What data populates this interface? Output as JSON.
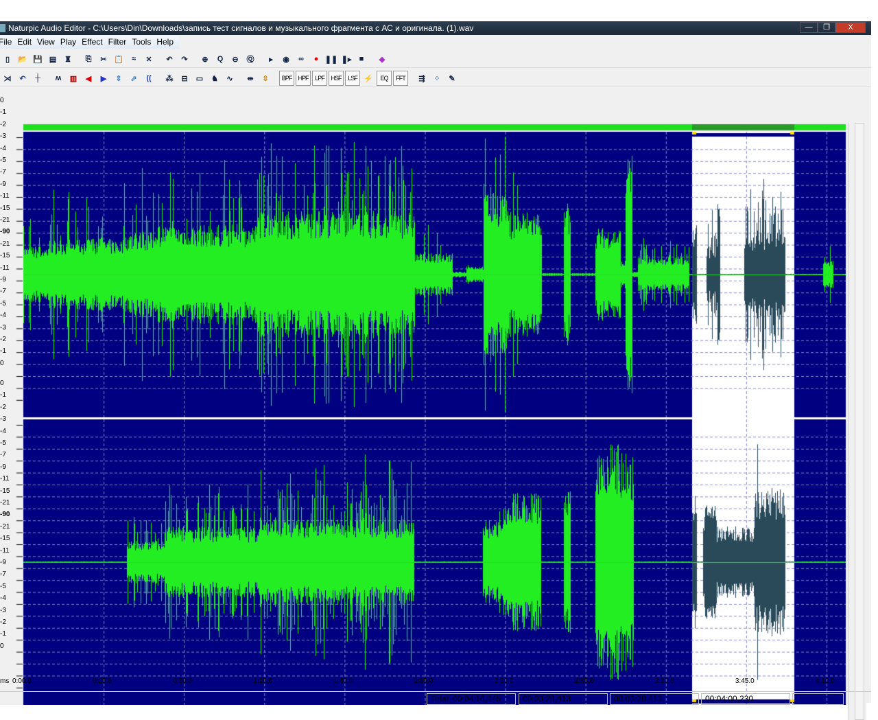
{
  "window": {
    "title": "Naturpic Audio Editor - C:\\Users\\Din\\Downloads\\запись тест сигналов и музыкального фрагмента с АС и оригинала. (1).wav",
    "minimize": "—",
    "restore": "❐",
    "close": "X"
  },
  "menu": [
    "File",
    "Edit",
    "View",
    "Play",
    "Effect",
    "Filter",
    "Tools",
    "Help"
  ],
  "toolbar1": [
    {
      "icon": "new-icon",
      "g": "▯"
    },
    {
      "icon": "open-icon",
      "g": "📂"
    },
    {
      "icon": "save-icon",
      "g": "💾"
    },
    {
      "icon": "properties-icon",
      "g": "▤"
    },
    {
      "icon": "tuning-icon",
      "g": "♜"
    },
    {
      "sep": true
    },
    {
      "icon": "copy-icon",
      "g": "⎘"
    },
    {
      "icon": "cut-icon",
      "g": "✂"
    },
    {
      "icon": "paste-icon",
      "g": "📋"
    },
    {
      "icon": "mix-paste-icon",
      "g": "≈"
    },
    {
      "icon": "delete-icon",
      "g": "✕"
    },
    {
      "sep": true
    },
    {
      "icon": "undo-icon",
      "g": "↶"
    },
    {
      "icon": "redo-icon",
      "g": "↷"
    },
    {
      "sep": true
    },
    {
      "icon": "zoom-in-icon",
      "g": "⊕"
    },
    {
      "icon": "zoom-selection-icon",
      "g": "Q"
    },
    {
      "icon": "zoom-out-icon",
      "g": "⊖"
    },
    {
      "icon": "zoom-full-icon",
      "g": "Ⓠ"
    },
    {
      "sep": true
    },
    {
      "icon": "play-icon",
      "g": "▸"
    },
    {
      "icon": "play-selection-icon",
      "g": "◉"
    },
    {
      "icon": "loop-icon",
      "g": "∞"
    },
    {
      "icon": "record-icon",
      "g": "●",
      "c": "#e00"
    },
    {
      "icon": "pause-icon",
      "g": "❚❚"
    },
    {
      "icon": "step-icon",
      "g": "❚▸"
    },
    {
      "icon": "stop-icon",
      "g": "■"
    },
    {
      "sep": true
    },
    {
      "icon": "help-book-icon",
      "g": "◆",
      "c": "#a3c"
    }
  ],
  "toolbar2": [
    {
      "icon": "trim-icon",
      "g": "⋊"
    },
    {
      "icon": "reverse-icon",
      "g": "↶",
      "c": "#24a"
    },
    {
      "icon": "split-icon",
      "g": "┼"
    },
    {
      "sep": true
    },
    {
      "icon": "amplify-icon",
      "g": "ʍ"
    },
    {
      "icon": "normalize-icon",
      "g": "▥",
      "c": "#a00"
    },
    {
      "icon": "fade-in-icon",
      "g": "◀",
      "c": "#d00"
    },
    {
      "icon": "fade-out-icon",
      "g": "▶",
      "c": "#23c"
    },
    {
      "icon": "volume-icon",
      "g": "⇕",
      "c": "#48c"
    },
    {
      "icon": "pan-icon",
      "g": "⇗",
      "c": "#48c"
    },
    {
      "icon": "echo-icon",
      "g": "((",
      "c": "#24a"
    },
    {
      "sep": true
    },
    {
      "icon": "noise-icon",
      "g": "⁂"
    },
    {
      "icon": "insert-silence-icon",
      "g": "⊟"
    },
    {
      "icon": "generate-tone-icon",
      "g": "▭"
    },
    {
      "icon": "chorus-icon",
      "g": "♞"
    },
    {
      "icon": "vibrato-icon",
      "g": "∿"
    },
    {
      "sep": true
    },
    {
      "icon": "stretch-icon",
      "g": "⇹"
    },
    {
      "icon": "pitch-icon",
      "g": "⇳",
      "c": "#c80"
    }
  ],
  "filters": [
    "BPF",
    "HPF",
    "LPF",
    "HSF",
    "LSF"
  ],
  "toolbar3": [
    {
      "icon": "custom-filter-icon",
      "g": "⚡",
      "c": "#cc0"
    }
  ],
  "eq_label": "EQ",
  "fft_label": "FFT",
  "toolbar4": [
    {
      "icon": "marker-icon",
      "g": "⇶"
    },
    {
      "icon": "spectrum-icon",
      "g": "⁘",
      "c": "#48c"
    },
    {
      "icon": "edit-graph-icon",
      "g": "✎"
    }
  ],
  "scale_labels": [
    "0",
    "-1",
    "-2",
    "-3",
    "-4",
    "-5",
    "-7",
    "-9",
    "-11",
    "-15",
    "-21",
    "-90",
    "-21",
    "-15",
    "-11",
    "-9",
    "-7",
    "-5",
    "-4",
    "-3",
    "-2",
    "-1",
    "0"
  ],
  "time_unit": "ms",
  "time_labels": [
    "0:00.0",
    "0:25.0",
    "0:50.0",
    "1:15.0",
    "1:40.0",
    "2:05.0",
    "2:30.0",
    "2:55.0",
    "3:20.0",
    "3:45.0",
    "4:10.0"
  ],
  "status": {
    "total": "Total: 00:04:16,245",
    "cursor": "00:03:28,413",
    "sel_start": "00:03:28,413",
    "sel_end": "00:04:00,230"
  },
  "colors": {
    "background": "#000080",
    "wave": "#22ee22",
    "selected_wave": "#2a4a5a",
    "selection": "#ffffff"
  }
}
